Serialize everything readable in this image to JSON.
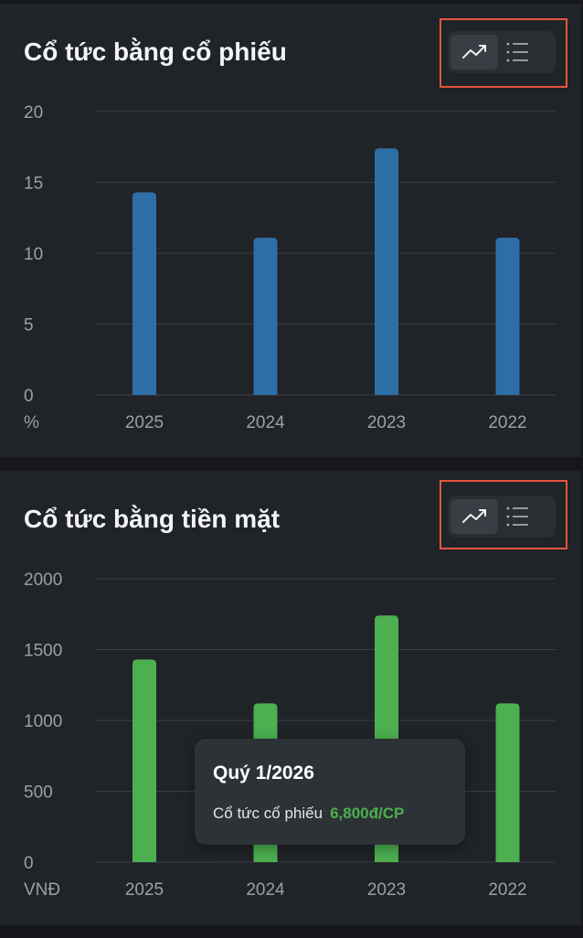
{
  "charts": [
    {
      "title": "Cổ tức bằng cổ phiếu",
      "toggle": {
        "active": "trend-icon",
        "inactive": "list-icon"
      }
    },
    {
      "title": "Cổ tức bằng tiền mặt",
      "toggle": {
        "active": "trend-icon",
        "inactive": "list-icon"
      }
    }
  ],
  "colors": {
    "bar_stock": "#2e6ea6",
    "bar_cash": "#4caf50",
    "highlight": "#e2553e"
  },
  "tooltip": {
    "title": "Quý 1/2026",
    "label": "Cổ tức cổ phiếu",
    "value": "6,800đ/CP"
  },
  "chart_data": [
    {
      "type": "bar",
      "title": "Cổ tức bằng cổ phiếu",
      "categories": [
        "2025",
        "2024",
        "2023",
        "2022"
      ],
      "values": [
        14.3,
        11.1,
        17.4,
        11.1
      ],
      "yticks": [
        "0",
        "5",
        "10",
        "15",
        "20"
      ],
      "ylim": [
        0,
        20
      ],
      "unit_label": "%",
      "grid": true
    },
    {
      "type": "bar",
      "title": "Cổ tức bằng tiền mặt",
      "categories": [
        "2025",
        "2024",
        "2023",
        "2022"
      ],
      "values": [
        1430,
        1120,
        1740,
        1120
      ],
      "yticks": [
        "0",
        "500",
        "1000",
        "1500",
        "2000"
      ],
      "ylim": [
        0,
        2000
      ],
      "unit_label": "VNĐ",
      "grid": true
    }
  ]
}
